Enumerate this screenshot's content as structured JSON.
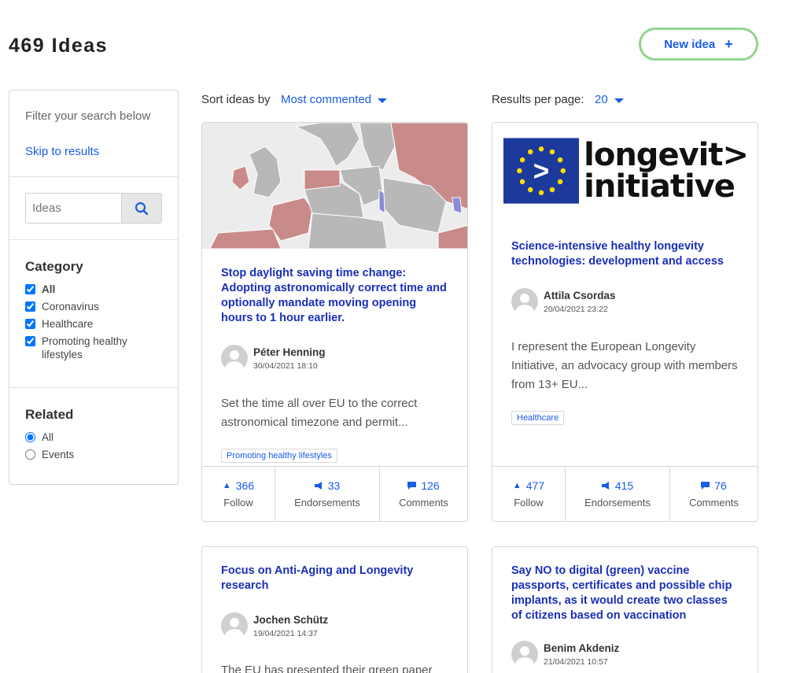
{
  "header": {
    "title": "469 Ideas",
    "new_idea_label": "New idea",
    "new_idea_icon": "plus-icon"
  },
  "sidebar": {
    "filter_text": "Filter your search below",
    "skip_link": "Skip to results",
    "search": {
      "placeholder": "Ideas",
      "icon": "search-icon"
    },
    "category": {
      "heading": "Category",
      "options": [
        {
          "label": "All",
          "checked": true
        },
        {
          "label": "Coronavirus",
          "checked": true
        },
        {
          "label": "Healthcare",
          "checked": true
        },
        {
          "label": "Promoting healthy lifestyles",
          "checked": true
        }
      ]
    },
    "related": {
      "heading": "Related",
      "options": [
        {
          "label": "All",
          "selected": true
        },
        {
          "label": "Events",
          "selected": false
        }
      ]
    }
  },
  "sort": {
    "label": "Sort ideas by",
    "value": "Most commented"
  },
  "results": {
    "label": "Results per page:",
    "value": "20"
  },
  "cards": [
    {
      "title": "Stop daylight saving time change: Adopting astronomically correct time and optionally mandate moving opening hours to 1 hour earlier.",
      "author": "Péter Henning",
      "date": "30/04/2021 18:10",
      "excerpt": "Set the time all over EU to the correct astronomical timezone and permit...",
      "tag": "Promoting healthy lifestyles",
      "follow_count": "366",
      "follow_label": "Follow",
      "endorse_count": "33",
      "endorse_label": "Endorsements",
      "comment_count": "126",
      "comment_label": "Comments",
      "image": "europe-timezone-map"
    },
    {
      "title": "Science-intensive healthy longevity technologies: development and access",
      "author": "Attila Csordas",
      "date": "20/04/2021 23:22",
      "excerpt": "I represent the European Longevity Initiative, an advocacy group with members from 13+ EU...",
      "tag": "Healthcare",
      "follow_count": "477",
      "follow_label": "Follow",
      "endorse_count": "415",
      "endorse_label": "Endorsements",
      "comment_count": "76",
      "comment_label": "Comments",
      "logo_line1": "longevit>",
      "logo_line2": "initiative",
      "logo_symbol": ">"
    },
    {
      "title": "Focus on Anti-Aging and Longevity research",
      "author": "Jochen Schütz",
      "date": "19/04/2021 14:37",
      "excerpt": "The EU has presented their green paper"
    },
    {
      "title": "Say NO to digital (green) vaccine passports, certificates and possible chip implants, as it would create two classes of citizens based on vaccination",
      "author": "Benim Akdeniz",
      "date": "21/04/2021 10:57"
    }
  ],
  "colors": {
    "link": "#1a5ce6",
    "title": "#1a2fb8",
    "button_border": "#8fd68c",
    "map_red": "#c98a8a",
    "map_grey": "#b8b8b8",
    "map_blue": "#8a8ad6",
    "eu_blue": "#1b3a9c",
    "eu_star": "#ffdd00"
  }
}
